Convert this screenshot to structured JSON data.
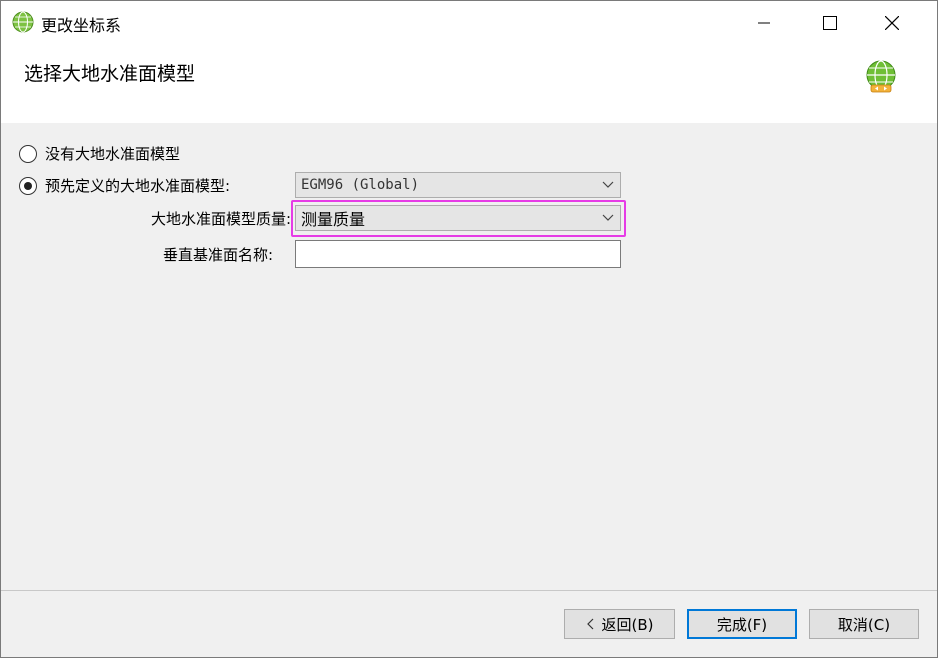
{
  "window": {
    "title": "更改坐标系",
    "controls": {
      "minimize": "minimize",
      "maximize": "maximize",
      "close": "close"
    }
  },
  "header": {
    "title": "选择大地水准面模型",
    "icon": "globe-arrows-icon"
  },
  "options": {
    "no_model_label": "没有大地水准面模型",
    "predefined_label": "预先定义的大地水准面模型:",
    "selected": "predefined"
  },
  "model_select": {
    "value": "EGM96 (Global)"
  },
  "quality": {
    "label": "大地水准面模型质量:",
    "value": "测量质量"
  },
  "vertical_datum": {
    "label": "垂直基准面名称:",
    "value": ""
  },
  "buttons": {
    "back": "返回(B)",
    "finish": "完成(F)",
    "cancel": "取消(C)"
  },
  "colors": {
    "accent": "#0078d7",
    "highlight": "#e63ce6",
    "globe_green": "#5cb82e"
  }
}
